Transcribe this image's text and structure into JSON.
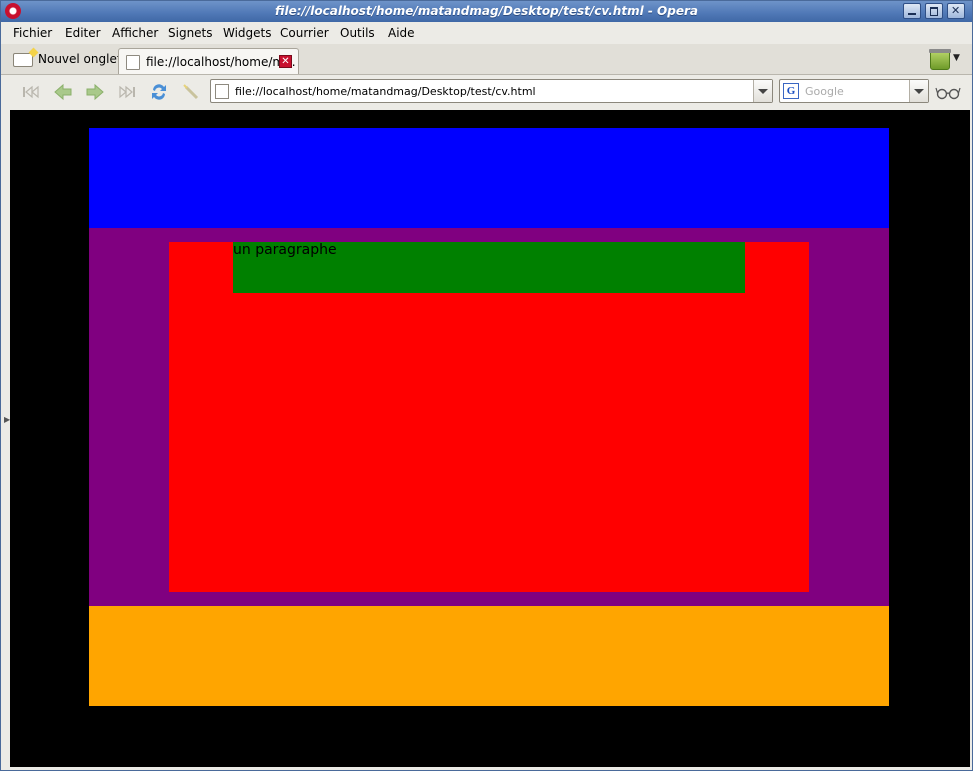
{
  "window": {
    "title": "file://localhost/home/matandmag/Desktop/test/cv.html - Opera"
  },
  "menu": [
    {
      "label": "Fichier"
    },
    {
      "label": "Editer"
    },
    {
      "label": "Afficher"
    },
    {
      "label": "Signets"
    },
    {
      "label": "Widgets"
    },
    {
      "label": "Courrier"
    },
    {
      "label": "Outils"
    },
    {
      "label": "Aide"
    }
  ],
  "tabs": {
    "new_tab_label": "Nouvel onglet",
    "active_tab_label": "file://localhost/home/m..."
  },
  "toolbar": {
    "address": "file://localhost/home/matandmag/Desktop/test/cv.html",
    "search_placeholder": "Google",
    "search_engine_icon": "G"
  },
  "page": {
    "paragraph": "un paragraphe",
    "colors": {
      "background": "#000000",
      "header": "#0000ff",
      "middle": "#800080",
      "content": "#ff0000",
      "paragraph": "#008000",
      "footer": "#ffa500"
    }
  }
}
